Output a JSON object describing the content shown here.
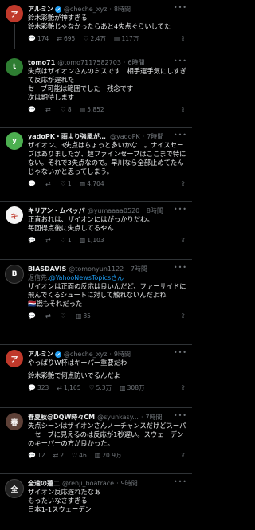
{
  "tweets": [
    {
      "name": "アルミン",
      "handle": "@cheche_xyz",
      "time": "8時間",
      "lines": [
        "鈴木彩艶が神すぎる",
        "鈴木彩艶じゃなかったらあと4失点ぐらいしてた"
      ],
      "replies": "174",
      "retweets": "695",
      "likes": "2.4万",
      "views": "117万",
      "avatar_color": "#c0392b",
      "avatar_text": "ア"
    },
    {
      "name": "tomo71",
      "handle": "@tomo7117582703",
      "time": "6時間",
      "lines": [
        "失点はザイオンさんのミスです　相手選手気にしすぎて反応が遅れた",
        "セーブ可能は範囲でした　残念です",
        "次は期待します"
      ],
      "replies": "",
      "retweets": "",
      "likes": "8",
      "views": "5,852",
      "avatar_color": "#2e7d32",
      "avatar_text": "t"
    },
    {
      "name": "yadoPK・雨より強風がいやな家",
      "handle": "@yadoPK",
      "time": "7時間",
      "lines": [
        "ザイオン、3失点はちょっと多いかな…。ナイスセーブはありましたが、超ファインセーブはここまで特にない。それで3失点なので。早川なら全部止めてたんじゃないかと思ってしまう。"
      ],
      "replies": "",
      "retweets": "",
      "likes": "1",
      "views": "4,704",
      "avatar_color": "#4caf50",
      "avatar_text": "y"
    },
    {
      "name": "キリアン・ムベッパ",
      "handle": "@yumaaaa0520",
      "time": "8時間",
      "lines": [
        "正直おれは、ザイオンにはがっかりだわ。",
        "毎回得点後に失点してるやん"
      ],
      "replies": "",
      "retweets": "",
      "likes": "1",
      "views": "1,103",
      "avatar_color": "#f5f5f5",
      "avatar_text": "キ"
    },
    {
      "name": "BIASDAVIS",
      "handle": "@tomonyun1122",
      "time": "7時間",
      "reply_prefix": "返信先:",
      "reply_target": "@YahooNewsTopicsさん",
      "lines": [
        "ザイオンは正面の反応は良いんだど、ファーサイドに飛んでくるシュートに対して触れないんだよね",
        "🇳🇱戦もそれだった"
      ],
      "replies": "",
      "retweets": "",
      "likes": "",
      "views": "85",
      "avatar_color": "#1a1a1a",
      "avatar_text": "B"
    },
    {
      "name": "アルミン",
      "handle": "@cheche_xyz",
      "time": "9時間",
      "lines": [
        "やっぱりW杯はキーパー重要だわ",
        "",
        "鈴木彩艶で何点防いでるんだよ"
      ],
      "replies": "323",
      "retweets": "1,165",
      "likes": "5.3万",
      "views": "308万",
      "avatar_color": "#c0392b",
      "avatar_text": "ア"
    },
    {
      "name": "春夏秋@DQW時々CM",
      "handle": "@syunkasy...",
      "time": "7時間",
      "lines": [
        "失点シーンはザイオンさんノーチャンスだけどスーパーセーブに見えるのは反応が1秒遅い。スウェーデンのキーパーの方が良かった。"
      ],
      "replies": "12",
      "retweets": "2",
      "likes": "46",
      "views": "20.9万",
      "avatar_color": "#5d4037",
      "avatar_text": "春"
    },
    {
      "name": "全速の蓮二",
      "handle": "@renji_boatrace",
      "time": "9時間",
      "lines": [
        "ザイオン反応遅れたなぁ",
        "もったいなさすぎる",
        "日本1-1スウェーデン"
      ],
      "replies": "",
      "retweets": "",
      "likes": "",
      "views": "",
      "avatar_color": "#222222",
      "avatar_text": "全"
    }
  ]
}
